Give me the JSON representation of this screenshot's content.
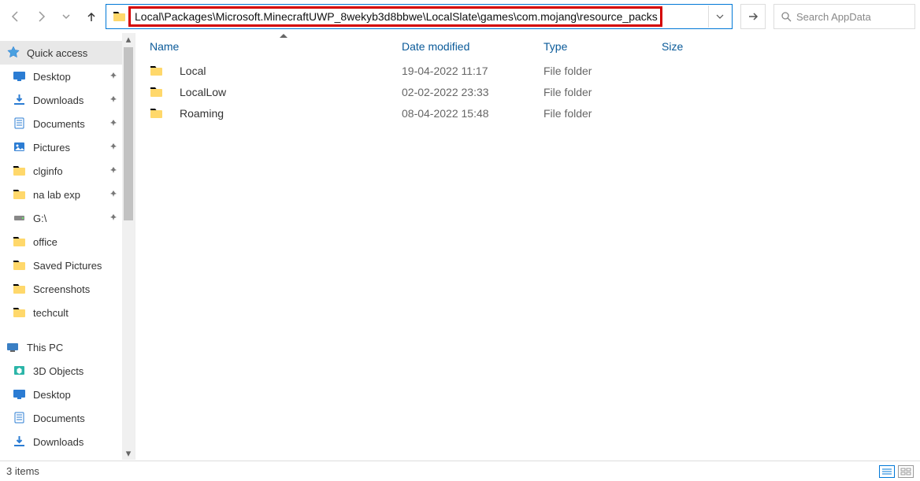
{
  "toolbar": {
    "address_text": "Local\\Packages\\Microsoft.MinecraftUWP_8wekyb3d8bbwe\\LocalSlate\\games\\com.mojang\\resource_packs",
    "search_placeholder": "Search AppData"
  },
  "sidebar": {
    "quick_access": "Quick access",
    "pinned": [
      {
        "label": "Desktop",
        "icon": "desktop"
      },
      {
        "label": "Downloads",
        "icon": "downloads"
      },
      {
        "label": "Documents",
        "icon": "documents"
      },
      {
        "label": "Pictures",
        "icon": "pictures"
      },
      {
        "label": "clginfo",
        "icon": "folder"
      },
      {
        "label": "na lab exp",
        "icon": "folder"
      },
      {
        "label": "G:\\",
        "icon": "drive"
      }
    ],
    "unpinned": [
      {
        "label": "office",
        "icon": "folder"
      },
      {
        "label": "Saved Pictures",
        "icon": "folder"
      },
      {
        "label": "Screenshots",
        "icon": "folder"
      },
      {
        "label": "techcult",
        "icon": "folder"
      }
    ],
    "this_pc": "This PC",
    "pc_items": [
      {
        "label": "3D Objects",
        "icon": "3d"
      },
      {
        "label": "Desktop",
        "icon": "desktop"
      },
      {
        "label": "Documents",
        "icon": "documents"
      },
      {
        "label": "Downloads",
        "icon": "downloads"
      }
    ]
  },
  "columns": {
    "name": "Name",
    "date": "Date modified",
    "type": "Type",
    "size": "Size"
  },
  "files": [
    {
      "name": "Local",
      "date": "19-04-2022 11:17",
      "type": "File folder",
      "size": ""
    },
    {
      "name": "LocalLow",
      "date": "02-02-2022 23:33",
      "type": "File folder",
      "size": ""
    },
    {
      "name": "Roaming",
      "date": "08-04-2022 15:48",
      "type": "File folder",
      "size": ""
    }
  ],
  "status": {
    "items": "3 items"
  }
}
